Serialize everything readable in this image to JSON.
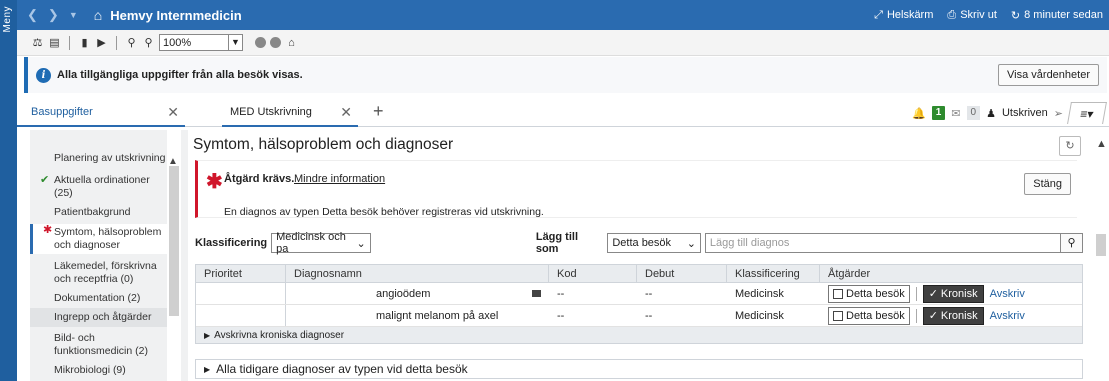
{
  "menu_strip": {
    "label": "Meny"
  },
  "topbar": {
    "title": "Hemvy Internmedicin",
    "fullscreen": "Helskärm",
    "print": "Skriv ut",
    "updated": "8 minuter sedan"
  },
  "toolbar": {
    "zoom": "100%"
  },
  "infobar": {
    "text": "Alla tillgängliga uppgifter från alla besök visas.",
    "button": "Visa vårdenheter"
  },
  "tabs": {
    "left": "Basuppgifter",
    "main": "MED Utskrivning",
    "badge_count": "1",
    "mail_count": "0",
    "status": "Utskriven"
  },
  "sidebar": {
    "items": [
      {
        "label": "Planering av utskrivning",
        "mark": ""
      },
      {
        "label": "Aktuella ordinationer (25)",
        "mark": "check"
      },
      {
        "label": "Patientbakgrund",
        "mark": ""
      },
      {
        "label": "Symtom, hälsoproblem och diagnoser",
        "mark": "star"
      },
      {
        "label": "Läkemedel, förskrivna och receptfria (0)",
        "mark": ""
      },
      {
        "label": "Dokumentation (2)",
        "mark": ""
      },
      {
        "label": "Ingrepp och åtgärder",
        "mark": ""
      },
      {
        "label": "Bild- och funktionsmedicin (2)",
        "mark": ""
      },
      {
        "label": "Mikrobiologi (9)",
        "mark": ""
      }
    ]
  },
  "main": {
    "title": "Symtom, hälsoproblem och diagnoser",
    "alert": {
      "head": "Åtgärd krävs.",
      "link": "Mindre information",
      "message": "En diagnos av typen Detta besök behöver registreras vid utskrivning.",
      "close": "Stäng"
    },
    "classification_label": "Klassificering",
    "classification_value": "Medicinsk och pa",
    "add_as_label": "Lägg till som",
    "add_as_value": "Detta besök",
    "search_placeholder": "Lägg till diagnos",
    "columns": [
      "Prioritet",
      "Diagnosnamn",
      "Kod",
      "Debut",
      "Klassificering",
      "Åtgärder"
    ],
    "rows": [
      {
        "priority": "",
        "name": "angioödem",
        "code": "--",
        "onset": "--",
        "classification": "Medicinsk",
        "this_visit": "Detta besök",
        "chronic": "Kronisk",
        "remove": "Avskriv"
      },
      {
        "priority": "",
        "name": "malignt melanom på axel",
        "code": "--",
        "onset": "--",
        "classification": "Medicinsk",
        "this_visit": "Detta besök",
        "chronic": "Kronisk",
        "remove": "Avskriv"
      }
    ],
    "chronic_footer": "Avskrivna kroniska diagnoser",
    "previous": "Alla tidigare diagnoser av typen vid detta besök"
  }
}
